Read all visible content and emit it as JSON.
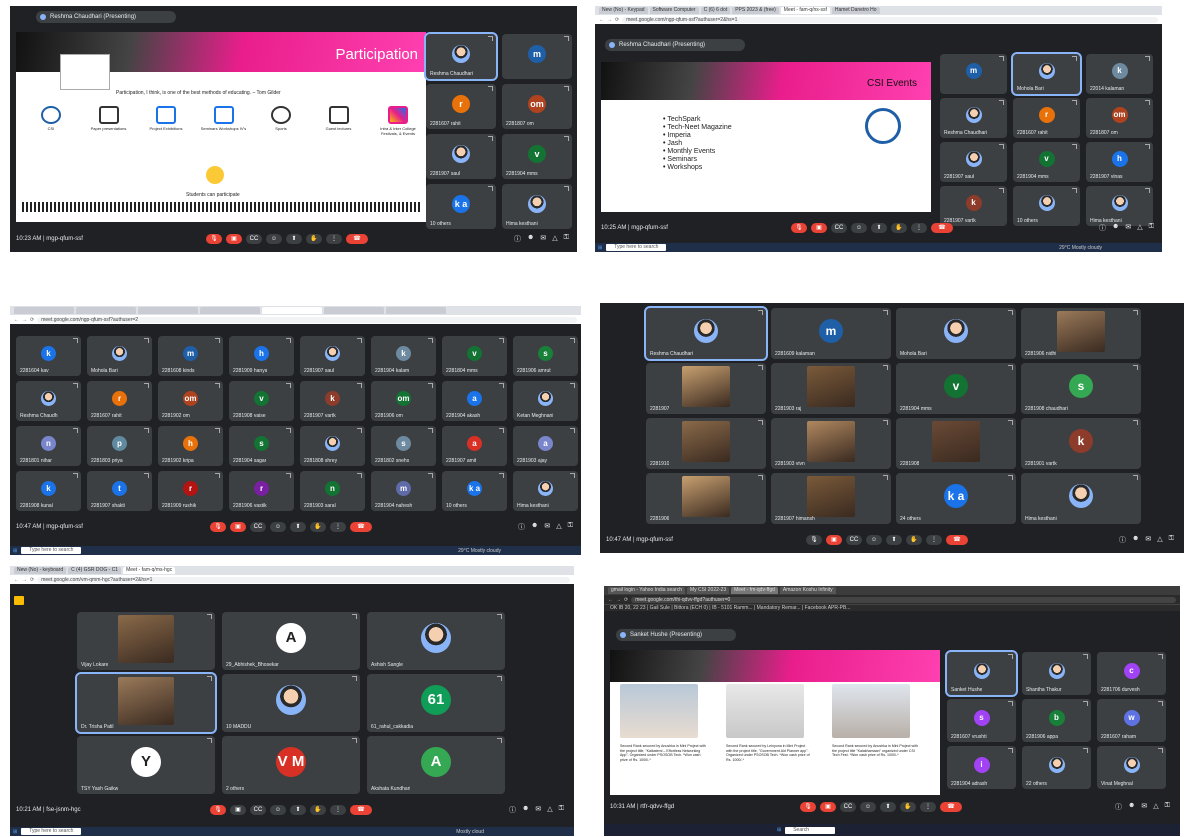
{
  "p1": {
    "presenter": "Reshma Chaudhari (Presenting)",
    "slide_title": "Participation",
    "quote": "Participation, I think, is one of the best methods of educating. – Tom Gilder",
    "icons": [
      "CSI",
      "Paper presentations",
      "Project Exhibitions",
      "Seminars Workshops IV's",
      "Sports",
      "Guest lectures",
      "Intra & Inter College Festivals, & Events"
    ],
    "footer": "Students can participate",
    "tiles": [
      {
        "name": "Reshma Chaudhari",
        "letter": "",
        "color": "#3c4043"
      },
      {
        "name": "",
        "letter": "m",
        "color": "#1e5fa8"
      },
      {
        "name": "2281607 rahit",
        "letter": "r",
        "color": "#e8710a"
      },
      {
        "name": "2281807 om",
        "letter": "om",
        "color": "#b0431f"
      },
      {
        "name": "2281907 saul",
        "letter": "",
        "color": "#3c4043"
      },
      {
        "name": "2281904 mms",
        "letter": "v",
        "color": "#137333"
      },
      {
        "name": "10 others",
        "letter": "k a",
        "color": "#1a73e8"
      },
      {
        "name": "Hima kesthani",
        "letter": "",
        "color": "#3c4043"
      }
    ],
    "time": "10:23 AM | mgp-qfum-ssf"
  },
  "p2": {
    "tabs": [
      "New (No) - Keypad",
      "Software Computer",
      "C (6) 6 dot",
      "PPS 2023 & (free)",
      "Meet - fam-q/ns-ssf",
      "Hamet Danetro Ho"
    ],
    "url": "meet.google.com/ngp-qfum-ssf?authuser=2&hs=1",
    "presenter": "Reshma Chaudhari (Presenting)",
    "slide_title": "CSI Events",
    "events": [
      "TechSpark",
      "Tech-Neet Magazine",
      "Imperia",
      "Jash",
      "Monthly Events",
      "Seminars",
      "Workshops"
    ],
    "tiles": [
      {
        "name": "",
        "letter": "m",
        "color": "#1e5fa8"
      },
      {
        "name": "Mohola Bari",
        "letter": "",
        "color": "#3c4043"
      },
      {
        "name": "22014 kalaman",
        "letter": "k",
        "color": "#6e8aa0"
      },
      {
        "name": "Reshma Chaudhari",
        "letter": "",
        "color": "#1a73e8"
      },
      {
        "name": "2281607 rahit",
        "letter": "r",
        "color": "#e8710a"
      },
      {
        "name": "2281807 om",
        "letter": "om",
        "color": "#b0431f"
      },
      {
        "name": "2281907 saul",
        "letter": "",
        "color": "#3c4043"
      },
      {
        "name": "2281904 mms",
        "letter": "v",
        "color": "#137333"
      },
      {
        "name": "2281907 vinas",
        "letter": "h",
        "color": "#1a73e8"
      },
      {
        "name": "2281907 vartk",
        "letter": "k",
        "color": "#8d3b2a"
      },
      {
        "name": "10 others",
        "letter": "",
        "color": "#3c4043"
      },
      {
        "name": "Hima kesthani",
        "letter": "",
        "color": "#3c4043"
      }
    ],
    "time": "10:25 AM | mgp-qfum-ssf",
    "search": "Type here to search",
    "tray": "29°C Mostly cloudy"
  },
  "p3": {
    "url": "meet.google.com/ngp-qfum-ssf?authuser=2",
    "tiles": [
      {
        "name": "2281604 kav",
        "letter": "k",
        "color": "#1a73e8"
      },
      {
        "name": "Mohola Bari",
        "letter": "",
        "color": "#3c4043"
      },
      {
        "name": "2281608 kinds",
        "letter": "m",
        "color": "#1e5fa8"
      },
      {
        "name": "2281909 hanya",
        "letter": "h",
        "color": "#1a73e8"
      },
      {
        "name": "2281907 saul",
        "letter": "",
        "color": "#3c4043"
      },
      {
        "name": "2281904 kalam",
        "letter": "k",
        "color": "#6e8aa0"
      },
      {
        "name": "2281804 mms",
        "letter": "v",
        "color": "#137333"
      },
      {
        "name": "2281906 amrut",
        "letter": "s",
        "color": "#188038"
      },
      {
        "name": "Reshma Chaudh",
        "letter": "",
        "color": "#1a73e8"
      },
      {
        "name": "2281607 rahit",
        "letter": "r",
        "color": "#e8710a"
      },
      {
        "name": "2281902 om",
        "letter": "om",
        "color": "#b0431f"
      },
      {
        "name": "2281908 vaise",
        "letter": "v",
        "color": "#137333"
      },
      {
        "name": "2281907 vartk",
        "letter": "k",
        "color": "#8d3b2a"
      },
      {
        "name": "2281906 om",
        "letter": "om",
        "color": "#137333"
      },
      {
        "name": "2281904 akash",
        "letter": "a",
        "color": "#1a73e8"
      },
      {
        "name": "Ketan Meghnani",
        "letter": "",
        "color": "#1a73e8"
      },
      {
        "name": "2281801 nihar",
        "letter": "n",
        "color": "#7986cb"
      },
      {
        "name": "2281803 priya",
        "letter": "p",
        "color": "#5f8aa0"
      },
      {
        "name": "2281902 kripa",
        "letter": "h",
        "color": "#e8710a"
      },
      {
        "name": "2281904 sagar",
        "letter": "s",
        "color": "#137333"
      },
      {
        "name": "2281808 shrey",
        "letter": "",
        "color": "#3c4043"
      },
      {
        "name": "2281802 snehs",
        "letter": "s",
        "color": "#6e8aa0"
      },
      {
        "name": "2281907 amit",
        "letter": "a",
        "color": "#d93025"
      },
      {
        "name": "2281903 ajay",
        "letter": "a",
        "color": "#7986cb"
      },
      {
        "name": "2281908 kunal",
        "letter": "k",
        "color": "#1a73e8"
      },
      {
        "name": "2281907 shakti",
        "letter": "t",
        "color": "#1a73e8"
      },
      {
        "name": "2281909 rushik",
        "letter": "r",
        "color": "#b31412"
      },
      {
        "name": "2281906 vastik",
        "letter": "r",
        "color": "#7b1fa2"
      },
      {
        "name": "2281903 saral",
        "letter": "n",
        "color": "#137333"
      },
      {
        "name": "2281904 nahesh",
        "letter": "m",
        "color": "#5f6ba8"
      },
      {
        "name": "10 others",
        "letter": "k a",
        "color": "#1a73e8"
      },
      {
        "name": "Hima kesthani",
        "letter": "",
        "color": "#3c4043"
      }
    ],
    "time": "10:47 AM | mgp-qfum-ssf",
    "search": "Type here to search",
    "tray": "29°C Mostly cloudy"
  },
  "p4": {
    "tiles": [
      {
        "name": "Reshma Chaudhari",
        "letter": "",
        "color": "#3c4043"
      },
      {
        "name": "2281609 kalaman",
        "letter": "m",
        "color": "#1e5fa8"
      },
      {
        "name": "Mohola Bari",
        "letter": "",
        "color": "#3c4043"
      },
      {
        "name": "2281906 nidhi",
        "letter": "",
        "color": "#3c4043"
      },
      {
        "name": "2281907",
        "letter": "",
        "color": "#3c4043"
      },
      {
        "name": "2281903 raj",
        "letter": "",
        "color": "#3c4043"
      },
      {
        "name": "2281904 mms",
        "letter": "v",
        "color": "#137333"
      },
      {
        "name": "2281908 chaudhari",
        "letter": "s",
        "color": "#34a853"
      },
      {
        "name": "2281910",
        "letter": "",
        "color": "#3c4043"
      },
      {
        "name": "2281903 vivn",
        "letter": "",
        "color": "#3c4043"
      },
      {
        "name": "2281908",
        "letter": "",
        "color": "#3c4043"
      },
      {
        "name": "2281901 vartk",
        "letter": "k",
        "color": "#8d3b2a"
      },
      {
        "name": "2281906",
        "letter": "",
        "color": "#3c4043"
      },
      {
        "name": "2281907 himansh",
        "letter": "",
        "color": "#3c4043"
      },
      {
        "name": "24 others",
        "letter": "k a",
        "color": "#1a73e8"
      },
      {
        "name": "Hima kesthani",
        "letter": "",
        "color": "#3c4043"
      }
    ],
    "time": "10:47 AM | mgp-qfum-ssf"
  },
  "p5": {
    "tabs": [
      "New (No) - keyboard",
      "C (4) GSR DOG - C1",
      "Meet - fam-q/ms-hgc"
    ],
    "url": "meet.google.com/vm-qmm-hgc?authuser=2&hs=1",
    "tiles": [
      {
        "name": "Vijay Lokare",
        "letter": "",
        "color": "#3c4043"
      },
      {
        "name": "29_Abhishek_Bhosekar",
        "letter": "A",
        "color": "#fff"
      },
      {
        "name": "Ashish Sangle",
        "letter": "",
        "color": "#3c4043"
      },
      {
        "name": "Dr. Trisha Patil",
        "letter": "",
        "color": "#3c4043"
      },
      {
        "name": "10 MADDU",
        "letter": "",
        "color": "#7b4ad1"
      },
      {
        "name": "61_rahul_cakkadia",
        "letter": "61",
        "color": "#0f9d58"
      },
      {
        "name": "TSY Yash Gaikw",
        "letter": "Y",
        "color": "#fff"
      },
      {
        "name": "2 others",
        "letter": "V M",
        "color": "#d93025"
      },
      {
        "name": "Akshata Kundhari",
        "letter": "A",
        "color": "#34a853"
      }
    ],
    "time": "10:21 AM | fse-jsnm-hgc",
    "search": "Type here to search",
    "tray": "Mostly cloud"
  },
  "p6": {
    "tabs": [
      "gmail login - Yahoo India search",
      "My CSI 2022-23",
      "Meet - fm-qdv-ffgd",
      "Amazon Koshu Infinity"
    ],
    "url": "meet.google.com/thi-qdvv-ffgd?authuser=0",
    "bookmarks": "OK IB 20, 22 23 | Gail Sule | Bittora (ECH 0) | IB - 5101 Ramm... | Mandatory Remar... | Facebook APR-PB...",
    "presenter": "Sanket Hushe (Presenting)",
    "captions": [
      "Second Rank secured by Anushka in Mini Project with the project title, \"Kalkatemi – Effortless Networking App\". Organized under PSOSOB Tech. *Won cash prize of Rs. 1000/-*",
      "Second Rank secured by Leinyona in Mini Project with the project title, \"Government Aid Planner app\". Organized under PSOSOB Tech. *Won cash prize of Rs. 1000/-*",
      "Second Rank secured by Anushka in Mini Project with the project title \"Kalakhamaan\" organized under CSI Tech Fest. *Won cash prize of Rs. 1000/-*"
    ],
    "tiles": [
      {
        "name": "Sanket Hushe",
        "letter": "",
        "color": "#3c4043"
      },
      {
        "name": "Shantha Thakur",
        "letter": "",
        "color": "#3c4043"
      },
      {
        "name": "2281706 durvesh",
        "letter": "c",
        "color": "#a142f4"
      },
      {
        "name": "2281607 vrushti",
        "letter": "s",
        "color": "#a142f4"
      },
      {
        "name": "2281906 appa",
        "letter": "b",
        "color": "#188038"
      },
      {
        "name": "2281607 raham",
        "letter": "w",
        "color": "#5e72e4"
      },
      {
        "name": "2281904 adrash",
        "letter": "i",
        "color": "#a142f4"
      },
      {
        "name": "22 others",
        "letter": "",
        "color": "#3c4043"
      },
      {
        "name": "Vinat Meghnal",
        "letter": "",
        "color": "#3c4043"
      }
    ],
    "time": "10:31 AM | rtfr-qdvv-ffgd",
    "search": "Search"
  }
}
